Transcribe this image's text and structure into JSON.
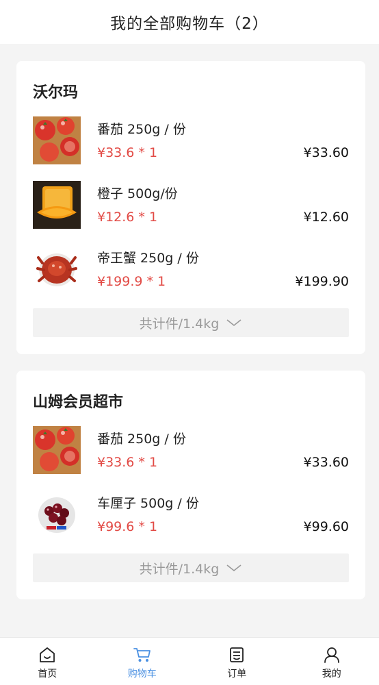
{
  "header": {
    "title": "我的全部购物车（2）"
  },
  "stores": [
    {
      "name": "沃尔玛",
      "items": [
        {
          "name": "番茄 250g / 份",
          "unit_price": "¥33.6 * 1",
          "total": "¥33.60",
          "image": "tomato"
        },
        {
          "name": "橙子 500g/份",
          "unit_price": "¥12.6 * 1",
          "total": "¥12.60",
          "image": "orange"
        },
        {
          "name": "帝王蟹 250g / 份",
          "unit_price": "¥199.9 * 1",
          "total": "¥199.90",
          "image": "crab"
        }
      ],
      "summary": "共计件/1.4kg"
    },
    {
      "name": "山姆会员超市",
      "items": [
        {
          "name": "番茄 250g / 份",
          "unit_price": "¥33.6 * 1",
          "total": "¥33.60",
          "image": "tomato"
        },
        {
          "name": "车厘子 500g / 份",
          "unit_price": "¥99.6 * 1",
          "total": "¥99.60",
          "image": "cherry"
        }
      ],
      "summary": "共计件/1.4kg"
    }
  ],
  "tabbar": {
    "active_color": "#4a90e2",
    "items": [
      {
        "label": "首页",
        "icon": "home-icon"
      },
      {
        "label": "购物车",
        "icon": "cart-icon"
      },
      {
        "label": "订单",
        "icon": "order-icon"
      },
      {
        "label": "我的",
        "icon": "user-icon"
      }
    ]
  },
  "colors": {
    "price_red": "#e24a45",
    "background": "#f4f4f4"
  }
}
